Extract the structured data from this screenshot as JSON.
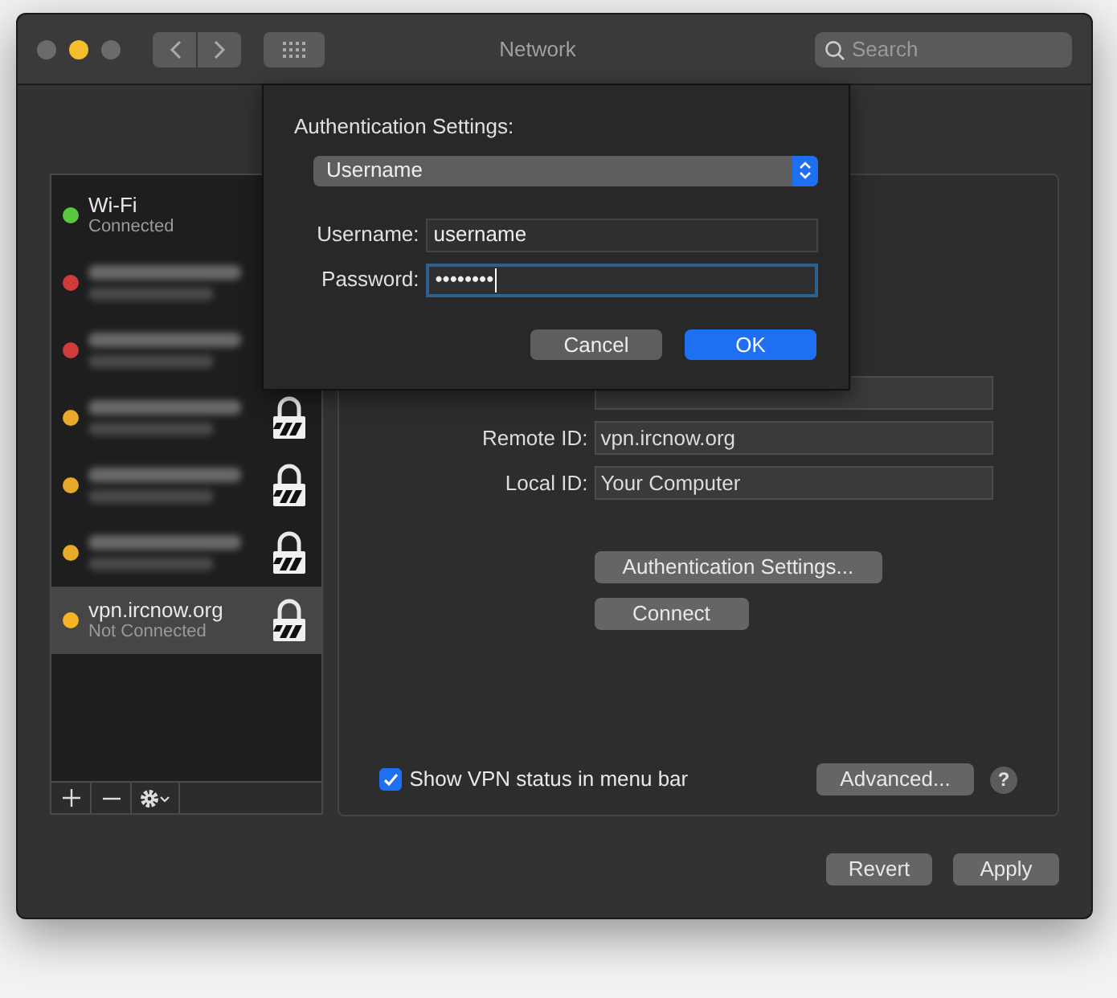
{
  "window": {
    "title": "Network",
    "search": {
      "placeholder": "Search"
    }
  },
  "services": [
    {
      "kind": "plain",
      "name": "Wi-Fi",
      "status": "Connected",
      "color": "#5ac83e",
      "locked": false,
      "selected": false
    },
    {
      "kind": "blurred",
      "color": "#d03b3b",
      "locked": false,
      "selected": false
    },
    {
      "kind": "blurred",
      "color": "#d03b3b",
      "locked": false,
      "selected": false
    },
    {
      "kind": "blurred",
      "color": "#e6a92a",
      "locked": true,
      "selected": false
    },
    {
      "kind": "blurred",
      "color": "#e6a92a",
      "locked": true,
      "selected": false
    },
    {
      "kind": "blurred",
      "color": "#e6a92a",
      "locked": true,
      "selected": false
    },
    {
      "kind": "plain",
      "name": "vpn.ircnow.org",
      "status": "Not Connected",
      "color": "#f5b325",
      "locked": true,
      "selected": true
    }
  ],
  "fields": [
    {
      "label": "Remote ID:",
      "value": "vpn.ircnow.org"
    },
    {
      "label": "Local ID:",
      "value": "Your Computer"
    }
  ],
  "panel_buttons": [
    "Authentication Settings...",
    "Connect"
  ],
  "show_vpn_status": {
    "label": "Show VPN status in menu bar",
    "checked": true
  },
  "advanced_button": "Advanced...",
  "help_button": "?",
  "footer_buttons": [
    "Revert",
    "Apply"
  ],
  "dialog": {
    "title": "Authentication Settings:",
    "method": "Username",
    "fields": [
      {
        "label": "Username:",
        "value": "username",
        "focused": false
      },
      {
        "label": "Password:",
        "value": "••••••••",
        "focused": true
      }
    ],
    "buttons": [
      {
        "label": "Cancel",
        "default": false
      },
      {
        "label": "OK",
        "default": true
      }
    ]
  }
}
